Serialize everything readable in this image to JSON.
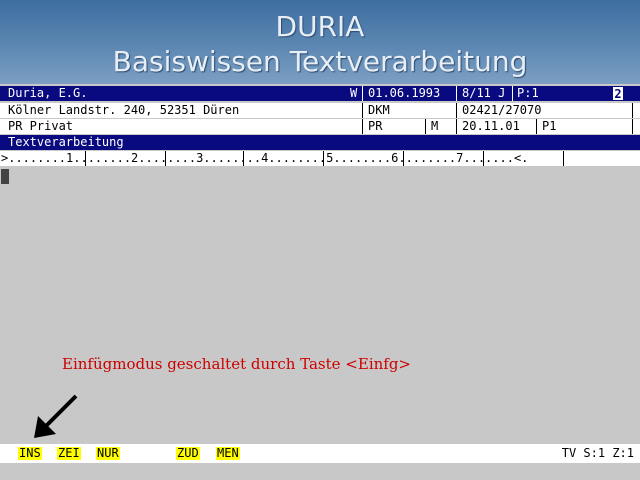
{
  "title": {
    "line1": "DURIA",
    "line2": "Basiswissen Textverarbeitung"
  },
  "record": {
    "row1": {
      "name": "Duria, E.G.",
      "flag": "W",
      "date": "01.06.1993",
      "code": "8/11 J",
      "page": "P:1",
      "num": "2"
    },
    "row2": {
      "address": "Kölner Landstr. 240, 52351 Düren",
      "dept": "DKM",
      "phone": "02421/27070"
    },
    "row3": {
      "type": "PR Privat",
      "type_code": "PR",
      "gender": "M",
      "date2": "20.11.01",
      "p": "P1"
    }
  },
  "doc_title": "Textverarbeitung",
  "ruler": ">........1........2........3........4........5........6........7.......<.",
  "annotation": "Einfügmodus geschaltet durch Taste <Einfg>",
  "arrow_icon": "arrow-down-left-icon",
  "status": {
    "items": [
      "INS",
      "ZEI",
      "NUR",
      "ZUD",
      "MEN"
    ],
    "right": "TV S:1 Z:1"
  },
  "colors": {
    "bar_blue": "#0a0a80",
    "highlight": "#ffff00",
    "annotation": "#cc0000"
  }
}
